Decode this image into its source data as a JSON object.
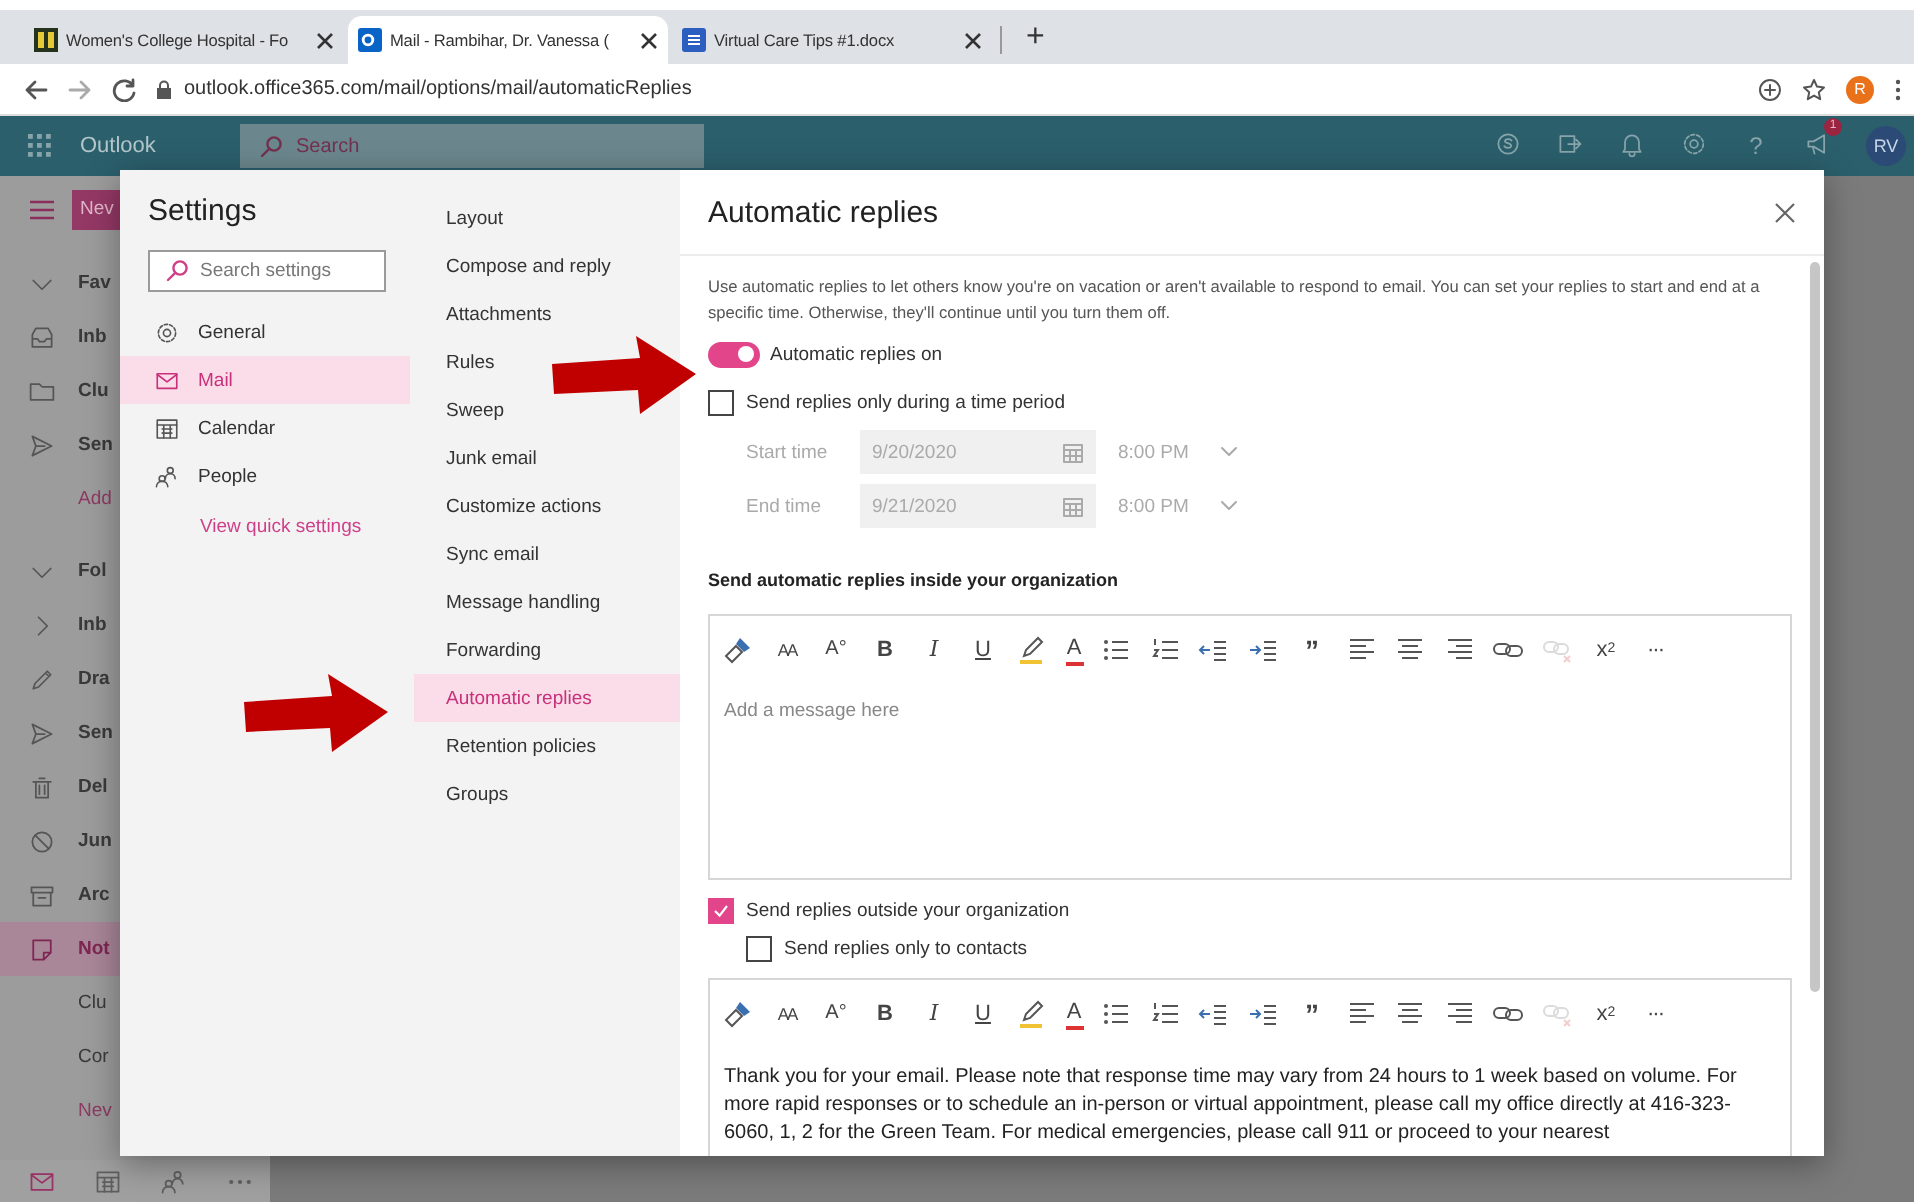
{
  "browser": {
    "tabs": [
      {
        "kind": "hospital",
        "title": "Women's College Hospital - Fo",
        "selected": false
      },
      {
        "kind": "outlook",
        "title": "Mail - Rambihar, Dr. Vanessa (",
        "selected": true
      },
      {
        "kind": "word",
        "title": "Virtual Care Tips #1.docx",
        "selected": false
      }
    ],
    "new_tab": "+",
    "url": "outlook.office365.com/mail/options/mail/automaticReplies",
    "profile_initial": "R"
  },
  "outlook": {
    "app_name": "Outlook",
    "search_placeholder": "Search",
    "new_button": "Nev",
    "header_icons": [
      {
        "kind": "skype"
      },
      {
        "kind": "share"
      },
      {
        "kind": "bell"
      },
      {
        "kind": "gear"
      },
      {
        "kind": "help",
        "text": "?"
      },
      {
        "kind": "megaphone",
        "badge": "1"
      }
    ],
    "avatar": "RV",
    "nav_items": [
      {
        "kind": "section",
        "label": "Fav",
        "selected": false
      },
      {
        "kind": "inbox",
        "label": "Inb",
        "selected": false
      },
      {
        "kind": "folder",
        "label": "Clu",
        "selected": false
      },
      {
        "kind": "sent",
        "label": "Sen",
        "selected": false
      },
      {
        "kind": "link",
        "label": "Add",
        "selected": false
      },
      {
        "kind": "section",
        "label": "Fol",
        "selected": false
      },
      {
        "kind": "expand",
        "label": "Inb",
        "selected": false
      },
      {
        "kind": "draft",
        "label": "Dra",
        "selected": false
      },
      {
        "kind": "sent",
        "label": "Sen",
        "selected": false
      },
      {
        "kind": "trash",
        "label": "Del",
        "selected": false
      },
      {
        "kind": "junk",
        "label": "Jun",
        "selected": false
      },
      {
        "kind": "archive",
        "label": "Arc",
        "selected": false
      },
      {
        "kind": "note",
        "label": "Not",
        "selected": true
      },
      {
        "kind": "plain",
        "label": "Clu",
        "selected": false
      },
      {
        "kind": "plain",
        "label": "Cor",
        "selected": false
      },
      {
        "kind": "link",
        "label": "Nev",
        "selected": false
      }
    ],
    "bottom_apps": [
      {
        "kind": "mail",
        "selected": true
      },
      {
        "kind": "calendar",
        "selected": false
      },
      {
        "kind": "people",
        "selected": false
      },
      {
        "kind": "more",
        "selected": false
      }
    ]
  },
  "settings": {
    "title": "Settings",
    "search_placeholder": "Search settings",
    "categories": [
      {
        "kind": "general",
        "label": "General",
        "selected": false
      },
      {
        "kind": "mail",
        "label": "Mail",
        "selected": true
      },
      {
        "kind": "calendar",
        "label": "Calendar",
        "selected": false
      },
      {
        "kind": "people",
        "label": "People",
        "selected": false
      }
    ],
    "quick_settings_link": "View quick settings",
    "subcategories": [
      {
        "label": "Layout",
        "selected": false
      },
      {
        "label": "Compose and reply",
        "selected": false
      },
      {
        "label": "Attachments",
        "selected": false
      },
      {
        "label": "Rules",
        "selected": false
      },
      {
        "label": "Sweep",
        "selected": false
      },
      {
        "label": "Junk email",
        "selected": false
      },
      {
        "label": "Customize actions",
        "selected": false
      },
      {
        "label": "Sync email",
        "selected": false
      },
      {
        "label": "Message handling",
        "selected": false
      },
      {
        "label": "Forwarding",
        "selected": false
      },
      {
        "label": "Automatic replies",
        "selected": true
      },
      {
        "label": "Retention policies",
        "selected": false
      },
      {
        "label": "Groups",
        "selected": false
      }
    ]
  },
  "automatic_replies": {
    "title": "Automatic replies",
    "description": "Use automatic replies to let others know you're on vacation or aren't available to respond to email. You can set your replies to start and end at a specific time. Otherwise, they'll continue until you turn them off.",
    "toggle": {
      "label": "Automatic replies on",
      "on": true
    },
    "time_period": {
      "label": "Send replies only during a time period",
      "checked": false
    },
    "times": [
      {
        "label": "Start time",
        "date": "9/20/2020",
        "time": "8:00 PM",
        "disabled": true
      },
      {
        "label": "End time",
        "date": "9/21/2020",
        "time": "8:00 PM",
        "disabled": true
      }
    ],
    "inside": {
      "heading": "Send automatic replies inside your organization",
      "placeholder": "Add a message here",
      "toolbar": [
        {
          "kind": "painter",
          "disabled": false
        },
        {
          "kind": "font-size",
          "text": "AA",
          "disabled": false
        },
        {
          "kind": "grow",
          "text": "A°",
          "disabled": false
        },
        {
          "kind": "bold",
          "text": "B",
          "disabled": false
        },
        {
          "kind": "italic",
          "text": "I",
          "disabled": false
        },
        {
          "kind": "underline",
          "text": "U",
          "disabled": false
        },
        {
          "kind": "highlight",
          "disabled": false
        },
        {
          "kind": "font-color",
          "text": "A",
          "disabled": false
        },
        {
          "kind": "bullets",
          "disabled": false
        },
        {
          "kind": "numbering",
          "disabled": false
        },
        {
          "kind": "outdent",
          "disabled": false
        },
        {
          "kind": "indent",
          "disabled": false
        },
        {
          "kind": "quote",
          "text": "”",
          "disabled": false
        },
        {
          "kind": "align-left",
          "disabled": false
        },
        {
          "kind": "align-center",
          "disabled": false
        },
        {
          "kind": "align-right",
          "disabled": false
        },
        {
          "kind": "link",
          "disabled": false
        },
        {
          "kind": "unlink",
          "disabled": true
        },
        {
          "kind": "superscript",
          "text": "x$^{2}$",
          "disabled": false
        },
        {
          "kind": "more",
          "text": "···",
          "disabled": false
        }
      ]
    },
    "outside": {
      "label": "Send replies outside your organization",
      "checked": true
    },
    "contacts_only": {
      "label": "Send replies only to contacts",
      "checked": false
    },
    "outside_editor": {
      "message": "Thank you for your email. Please note that response time may vary from 24 hours to 1 week based on volume. For more rapid responses or to schedule an in-person or virtual appointment, please call my office directly at 416-323-6060, 1, 2 for the Green Team. For medical emergencies, please call 911 or proceed to your nearest",
      "toolbar": [
        {
          "kind": "painter",
          "disabled": false
        },
        {
          "kind": "font-size",
          "text": "AA",
          "disabled": false
        },
        {
          "kind": "grow",
          "text": "A°",
          "disabled": false
        },
        {
          "kind": "bold",
          "text": "B",
          "disabled": false
        },
        {
          "kind": "italic",
          "text": "I",
          "disabled": false
        },
        {
          "kind": "underline",
          "text": "U",
          "disabled": false
        },
        {
          "kind": "highlight",
          "disabled": false
        },
        {
          "kind": "font-color",
          "text": "A",
          "disabled": false
        },
        {
          "kind": "bullets",
          "disabled": false
        },
        {
          "kind": "numbering",
          "disabled": false
        },
        {
          "kind": "outdent",
          "disabled": false
        },
        {
          "kind": "indent",
          "disabled": false
        },
        {
          "kind": "quote",
          "text": "”",
          "disabled": false
        },
        {
          "kind": "align-left",
          "disabled": false
        },
        {
          "kind": "align-center",
          "disabled": false
        },
        {
          "kind": "align-right",
          "disabled": false
        },
        {
          "kind": "link",
          "disabled": false
        },
        {
          "kind": "unlink",
          "disabled": true
        },
        {
          "kind": "superscript",
          "text": "x$^{2}$",
          "disabled": false
        },
        {
          "kind": "more",
          "text": "···",
          "disabled": false
        }
      ]
    }
  }
}
